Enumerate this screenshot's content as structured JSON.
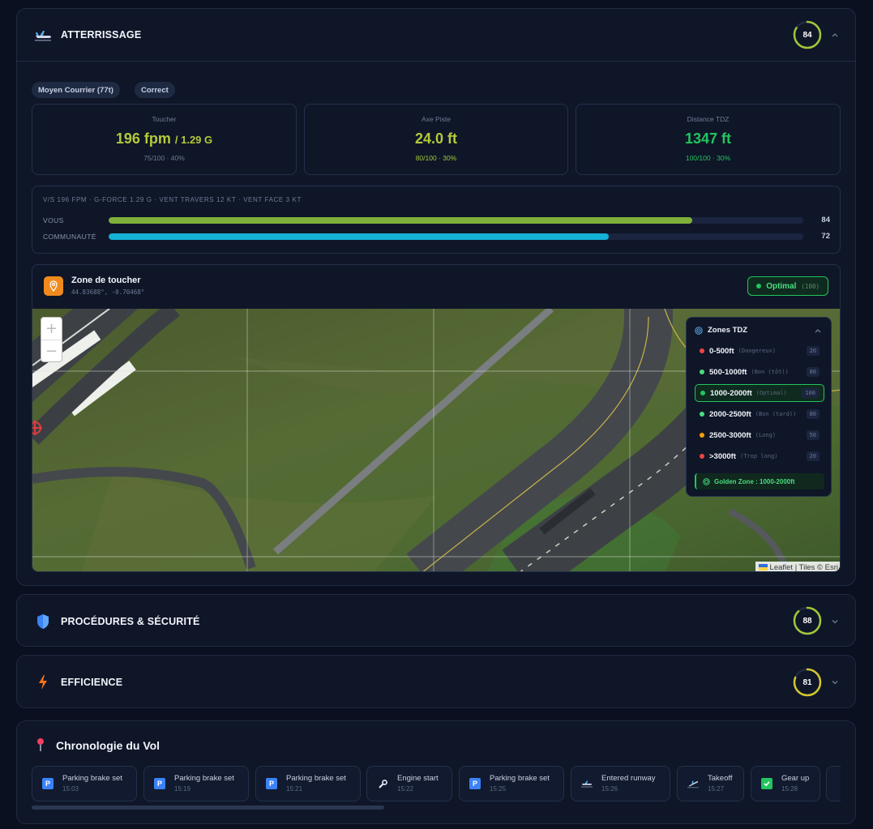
{
  "landing": {
    "title": "ATTERRISSAGE",
    "score": "84",
    "tags": [
      "Moyen Courrier (77t)",
      "Correct"
    ],
    "stats": [
      {
        "label": "Toucher",
        "value": "196 fpm",
        "value_suffix": "/ 1.29 G",
        "sub": "75/100 · 40%",
        "color": "#b5c93a"
      },
      {
        "label": "Axe Piste",
        "value": "24.0 ft",
        "value_suffix": "",
        "sub": "80/100 · 30%",
        "color": "#b5c93a"
      },
      {
        "label": "Distance TDZ",
        "value": "1347 ft",
        "value_suffix": "",
        "sub": "100/100 · 30%",
        "color": "#22c55e"
      }
    ],
    "summary": "V/S 196 FPM · G-FORCE 1.29 G · VENT TRAVERS 12 KT · VENT FACE 3 KT",
    "compare": [
      {
        "label": "VOUS",
        "value": "84",
        "fraction": 0.84,
        "color": "#7fb13a"
      },
      {
        "label": "COMMUNAUTÉ",
        "value": "72",
        "fraction": 0.72,
        "color": "#13b2d6"
      }
    ],
    "touchdown": {
      "title": "Zone de toucher",
      "coords": "44.83688°, -0.70468°",
      "status": "Optimal",
      "status_score": "(100)",
      "zoom_in": "+",
      "zoom_out": "−",
      "attribution": "Leaflet | Tiles © Esri",
      "zones_title": "Zones TDZ",
      "zones": [
        {
          "range": "0-500ft",
          "note": "(Dangereux)",
          "score": "20",
          "color": "#ef4444",
          "active": false
        },
        {
          "range": "500-1000ft",
          "note": "(Bon (tôt))",
          "score": "80",
          "color": "#4ade80",
          "active": false
        },
        {
          "range": "1000-2000ft",
          "note": "(Optimal)",
          "score": "100",
          "color": "#22c55e",
          "active": true
        },
        {
          "range": "2000-2500ft",
          "note": "(Bon (tard))",
          "score": "80",
          "color": "#4ade80",
          "active": false
        },
        {
          "range": "2500-3000ft",
          "note": "(Long)",
          "score": "50",
          "color": "#f59e0b",
          "active": false
        },
        {
          "range": ">3000ft",
          "note": "(Trop long)",
          "score": "20",
          "color": "#ef4444",
          "active": false
        }
      ],
      "golden": "Golden Zone : 1000-2000ft"
    }
  },
  "procedures": {
    "title": "PROCÉDURES & SÉCURITÉ",
    "score": "88"
  },
  "efficiency": {
    "title": "EFFICIENCE",
    "score": "81"
  },
  "timeline": {
    "title": "Chronologie du Vol",
    "events": [
      {
        "name": "Parking brake set",
        "time": "15:03",
        "icon": "parking-icon"
      },
      {
        "name": "Parking brake set",
        "time": "15:19",
        "icon": "parking-icon"
      },
      {
        "name": "Parking brake set",
        "time": "15:21",
        "icon": "parking-icon"
      },
      {
        "name": "Engine start",
        "time": "15:22",
        "icon": "wrench-icon"
      },
      {
        "name": "Parking brake set",
        "time": "15:25",
        "icon": "parking-icon"
      },
      {
        "name": "Entered runway",
        "time": "15:26",
        "icon": "runway-icon"
      },
      {
        "name": "Takeoff",
        "time": "15:27",
        "icon": "takeoff-icon"
      },
      {
        "name": "Gear up",
        "time": "15:28",
        "icon": "check-icon"
      }
    ],
    "parking_letter": "P"
  }
}
